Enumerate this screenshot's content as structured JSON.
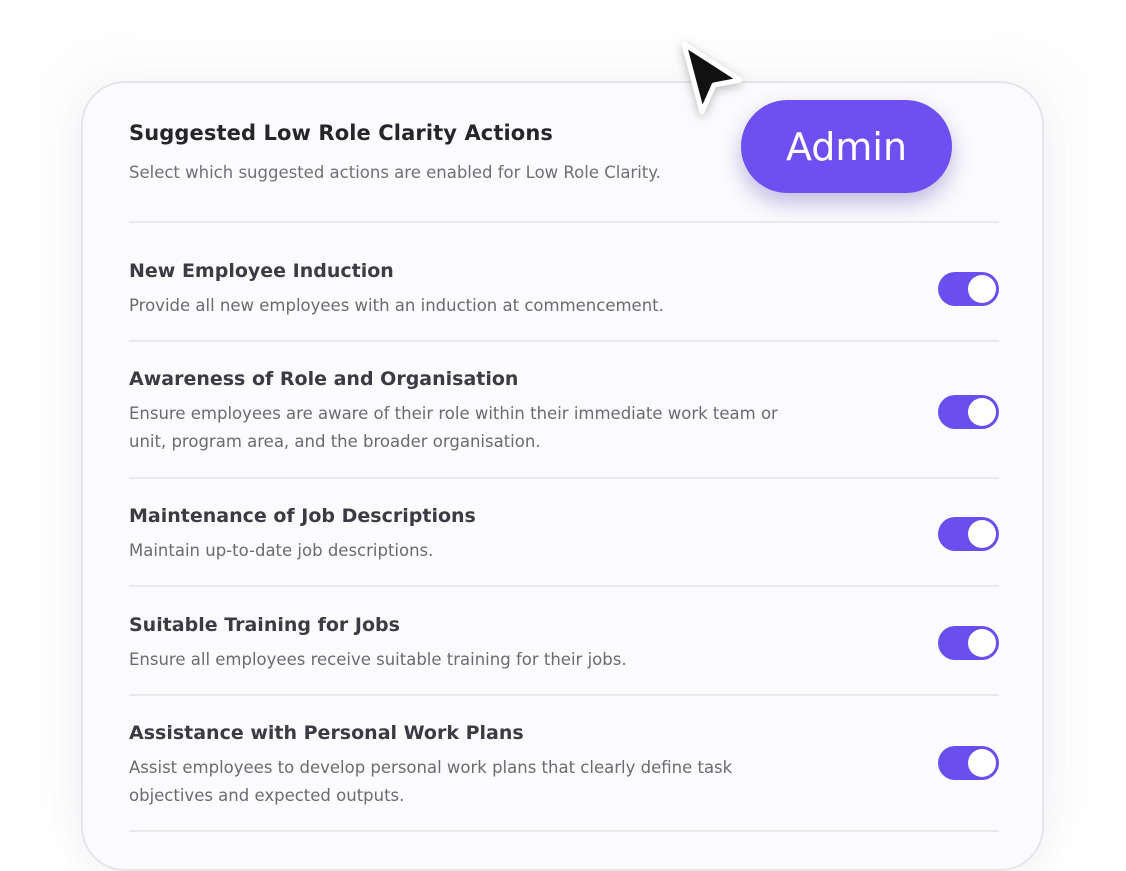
{
  "header": {
    "title": "Suggested Low Role Clarity Actions",
    "subtitle": "Select which suggested actions are enabled for Low Role Clarity."
  },
  "badge": {
    "label": "Admin"
  },
  "actions": [
    {
      "title": "New Employee Induction",
      "description": "Provide all new employees with an induction at commencement.",
      "enabled": true
    },
    {
      "title": "Awareness of Role and Organisation",
      "description": "Ensure employees are aware of their role within their immediate work team or unit, program area, and the broader organisation.",
      "enabled": true
    },
    {
      "title": "Maintenance of Job Descriptions",
      "description": "Maintain up-to-date job descriptions.",
      "enabled": true
    },
    {
      "title": "Suitable Training for Jobs",
      "description": "Ensure all employees receive suitable training for their jobs.",
      "enabled": true
    },
    {
      "title": "Assistance with Personal Work Plans",
      "description": "Assist employees to develop personal work plans that clearly define task objectives and expected outputs.",
      "enabled": true
    }
  ],
  "colors": {
    "accent": "#6b4ef0",
    "toggle_on": "#6b4ef0",
    "badge": "#6d4ff2"
  },
  "icons": {
    "cursor": "mouse-pointer-icon"
  }
}
